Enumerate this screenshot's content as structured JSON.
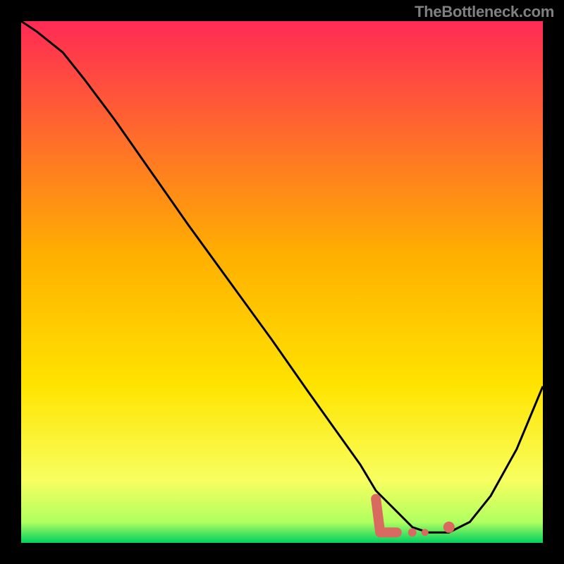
{
  "watermark": "TheBottleneck.com",
  "colors": {
    "background": "#000000",
    "gradient_top": "#ff2a55",
    "gradient_mid": "#ffd400",
    "gradient_low": "#f8ff60",
    "gradient_bottom": "#00d060",
    "curve": "#000000",
    "marker": "#d86a5f"
  },
  "chart_data": {
    "type": "line",
    "title": "",
    "xlabel": "",
    "ylabel": "",
    "xlim": [
      0,
      100
    ],
    "ylim": [
      0,
      100
    ],
    "series": [
      {
        "name": "bottleneck-curve",
        "x": [
          0,
          3,
          8,
          12,
          18,
          25,
          32,
          40,
          48,
          55,
          60,
          65,
          68,
          72,
          75,
          78,
          82,
          86,
          90,
          95,
          100
        ],
        "y": [
          100,
          98,
          94,
          89,
          81,
          71,
          61,
          50,
          39,
          29,
          22,
          15,
          10,
          6,
          3,
          2,
          2,
          4,
          9,
          18,
          30
        ]
      }
    ],
    "markers": [
      {
        "name": "L-shape",
        "x_range": [
          68,
          76
        ],
        "y_range": [
          2,
          6
        ]
      },
      {
        "name": "dot",
        "x": 82,
        "y": 3
      }
    ]
  }
}
